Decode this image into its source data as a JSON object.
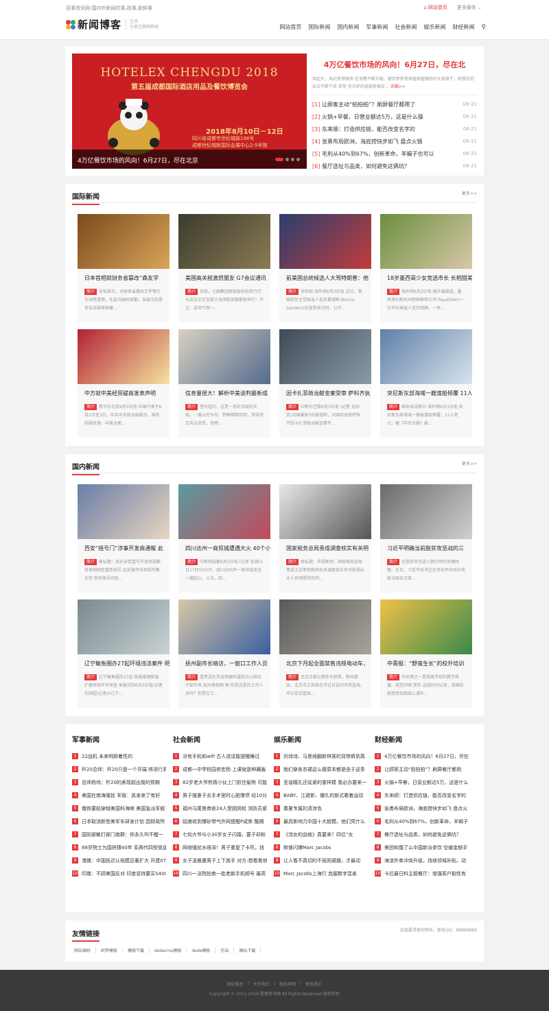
{
  "topbar": {
    "slogan": "百事资讯网-国内外新闻时事,政事,新鲜事",
    "home": "网站首页",
    "service": "更多服务"
  },
  "header": {
    "logo_text": "新闻博客",
    "logo_sub1": "主流",
    "logo_sub2": "分享互联网新闻"
  },
  "nav": [
    "网站首页",
    "国际新闻",
    "国内新闻",
    "军事新闻",
    "社会新闻",
    "娱乐新闻",
    "财经新闻"
  ],
  "hero": {
    "banner": {
      "title_en": "HOTELEX CHENGDU 2018",
      "title_cn": "第五届成都国际酒店用品及餐饮博览会",
      "date": "2018年8月10日－12日",
      "venue1": "四川省成都市世纪城路198号",
      "venue2": "成都世纪城新国际会展中心2-5号馆",
      "caption": "4万亿餐饮市场的风向！6月27日，尽在北京"
    },
    "headline": "4万亿餐饮市场的风向！6月27日，尽在北",
    "summary": "风起大，风向变得很快 在消费不断升级、餐饮跨界竞争越来越激烈的大背景下，新餐饮的玩法不断千奇 百怪 你怎样的选择能保证…",
    "more": "详细>>",
    "list": [
      {
        "n": "[1]",
        "t": "让顾客主动“拍拍拍”？刷屏餐厅都用了",
        "d": "06-21"
      },
      {
        "n": "[2]",
        "t": "火锅+早餐，日营业额达5万，这是什么操",
        "d": "06-21"
      },
      {
        "n": "[3]",
        "t": "东来顺：打造供应链，能否改变名字的",
        "d": "06-21"
      },
      {
        "n": "[4]",
        "t": "张勇布局欧洲，海底捞快步如飞 盘点火锅",
        "d": "06-21"
      },
      {
        "n": "[5]",
        "t": "毛利从40%到67%，创新革命，羊蝎子也可以",
        "d": "06-21"
      },
      {
        "n": "[6]",
        "t": "餐厅选址与品类，如何避免这俩坑？",
        "d": "06-21"
      }
    ]
  },
  "intl": {
    "title": "国际新闻",
    "more": "更多>>",
    "cards": [
      {
        "t": "日本首相就财务省篡改“森友学",
        "d": "安倍表示，对财务省篡改文件等行为深感遗憾，在此向国民致歉。当被问及是否会对副首相兼…"
      },
      {
        "t": "美国高关税激怒盟友 G7会议通讯",
        "d": "日前，七国集团财政部长和央行行长会议正在加拿大海滨胜地惠斯勒举行：不过，会场气氛一…"
      },
      {
        "t": "前美国总统候选人大骂特朗普：他",
        "d": "资料图 海外网6月3日电 近日，美国前民主党候选人伯尼桑德斯(Bernie Sanders)在接受采访时，公开…"
      },
      {
        "t": "18岁墨西哥少女竞选市长 长相甜美",
        "d": "海外网6月3日电 据外媒报道，墨西哥利斯科州特帕蒂特兰市(Tepatitlán)一位市长候选人走红网络。一名…"
      },
      {
        "t": "中方就中美经贸磋商发表声明",
        "d": "新华社北京6月3日电 中国代表于6月2日至3日，中共中央政治局委员、国务院副总理、中美全面…"
      },
      {
        "t": "信息量很大！解析中美谈判最新成",
        "d": "堂天超问，这是一场史诗级的大戏，一度山穷水尽，转瞬柳暗花明，但突然又风云突变，惊雨…"
      },
      {
        "t": "因卡扎菲政治献金案受审 萨科齐执",
        "d": "中新社巴黎6月3日电 (记者 龙剑武)法国媒体3日报道称，法国前总统萨科齐因卡扎菲政治献金事件…"
      },
      {
        "t": "突尼斯东部海域一艘渡船倾覆 11人",
        "d": "图来自法新社 海外网6月3日电 突尼斯东部海域一艘偷渡船倾覆，11人死亡。据《中东日报》报…"
      }
    ]
  },
  "domestic": {
    "title": "国内新闻",
    "more": "更多>>",
    "cards": [
      {
        "t": "西安“摇号门”涉事开发商通報 此",
        "d": "原标题：南长安街壹号开发商道歉 将增销网签重新摇号 此前曾传自目前所售住宅 前所摇号的商…"
      },
      {
        "t": "四川达州一商贸城遭遇大火 40个小",
        "d": "中新网成都6月3日电 (记者 张渊)1日17时55分许，四川达州开一商贸城发生一楼起火，火灾，四…"
      },
      {
        "t": "国家税务总局责成调查核实有关明",
        "d": "原标题：央视新闻：国家税务总局责成江苏等地税务机关调查核实有关影视从业人员明星阴合同…"
      },
      {
        "t": "习近平明确当前脱贫攻坚战的三",
        "d": "在脱贫攻坚进入倒计时的关键时期，近日，习近平总书记主持召开中共中央政治局会议审…"
      },
      {
        "t": "辽宁鲅鱼圈办27起环境违法案件 明",
        "d": "辽宁鲅鱼圈办27起 帐破案理新政扩建项目环评审查 本报沈阳6月3日电(记者刘洪超)记者从辽宁…"
      },
      {
        "t": "抚州副市长暗访，一窗口工作人员",
        "d": "暨责语在赤谷镇便民服务中心暗访于部作风 抚州章政网 图 你是这里的工作人员吗？你是在工…"
      },
      {
        "t": "北京下月起全面禁售违规电动车，",
        "d": "北京日报记者昨天获悉，新闻提出，北京市工商局日子近日会同市质监局、市公安交管局…"
      },
      {
        "t": "中青报：“野蛮生长”的校外培训",
        "d": "的关键之一是提高学校的教学质量。规范中国 资料 这段时间以来，我确实能感受到周围上课外…"
      }
    ]
  },
  "columns": [
    {
      "title": "军事新闻",
      "items": [
        "22战机 未来明即着性的",
        "歼20总师：歼20只是一个开端 将进行系",
        "总师杨伟：歼20的表现超出我的预期",
        "美国在南海骚扰 军报：凯发来了有好",
        "俄铁要船穿越美国科海峡 美国急派军舰",
        "日本取消新型美军车研发计划 因财政所",
        "国防部敏打部门南群：你永久叫不醒一",
        "88岁院士为国拼搏40年 系两代四型驱逐",
        "港媒：中国抵近认规模显著扩大 开建07",
        "印媒：不顾美国反对 印度坚持要买S400"
      ]
    },
    {
      "title": "社会新闻",
      "items": [
        "没有手机和wifi 古人说话能提醒睡过",
        "成都一中学校园丧宏杨 上课就是种藏轰",
        "82岁老大爷热情小伙上门抓住偷狗 可能",
        "男子搜妻子去手术室时心脏骤停 经10分",
        "福州马尾景商依24人受困阴校 消防员紧",
        "姑娘收到爆砂带气外网提醒P成焦 酷拥",
        "七旬大爷与小30岁女子闪婚，要子却和",
        "网络骚扰水很深！男子重复了卡死，钱",
        "女子凌晨遭男子上下其手 对方:想看看他",
        "四川一法院拍卖一批老款手机顺号 最高"
      ]
    },
    {
      "title": "娱乐新闻",
      "items": [
        "刘诗诗、马思纯翻新林客的背带裤到真",
        "她们穿各衣裙这么瘦原本都是由于这条",
        "圣诞瞳孔还延紧的童样模 我必办要来一",
        "BABY、江疏影、娜扎的新式裹着运动",
        "春夏专属的清凉色",
        "最具影响力中国十大超模，他们凭什么",
        "《流女的品格》真要来？四位“女",
        "默普闪爆Marc Jacobs",
        "让人看不真切的不规则裙摆，才最动",
        "Marc Jacobs上海行 克服数字混善"
      ]
    },
    {
      "title": "财经新闻",
      "items": [
        "4万亿餐饮市场的风向！6月27日，尽在",
        "让顾客主动“拍拍拍”？刷屏餐厅都用",
        "火锅+早餐，日营业额达5万，这是什么",
        "东来顺：打造供应链，能否改变名字的",
        "张勇布局欧洲，海底捞快步如飞 盘点火",
        "毛利从40%到67%，创新革命，羊蝎子",
        "餐厅选址与品类，如何避免这俩坑？",
        "美团和饿了么中国新派茶饮 空缓金额手",
        "海滨外卖冲突升级，持续领域补贴，动",
        "卡拉最日料主题餐厅：增强客户黏性有"
      ]
    }
  ],
  "links": {
    "title": "友情链接",
    "contact": "友链要求类型相关，联系QQ：88888888",
    "items": [
      "网站源码",
      "织梦模板",
      "模版下载",
      "dedecms模板",
      "dede模板",
      "仿站",
      "图标下载"
    ]
  },
  "footer": {
    "links": [
      "网站首页",
      "关于我们",
      "版权声明",
      "联系我们"
    ],
    "copyright": "Copyright © 2011-2018 星期资讯网 All Rights Reserved 版权所有"
  },
  "colors": {
    "accent": "#e4393c",
    "footer": "#3a3a3a"
  }
}
